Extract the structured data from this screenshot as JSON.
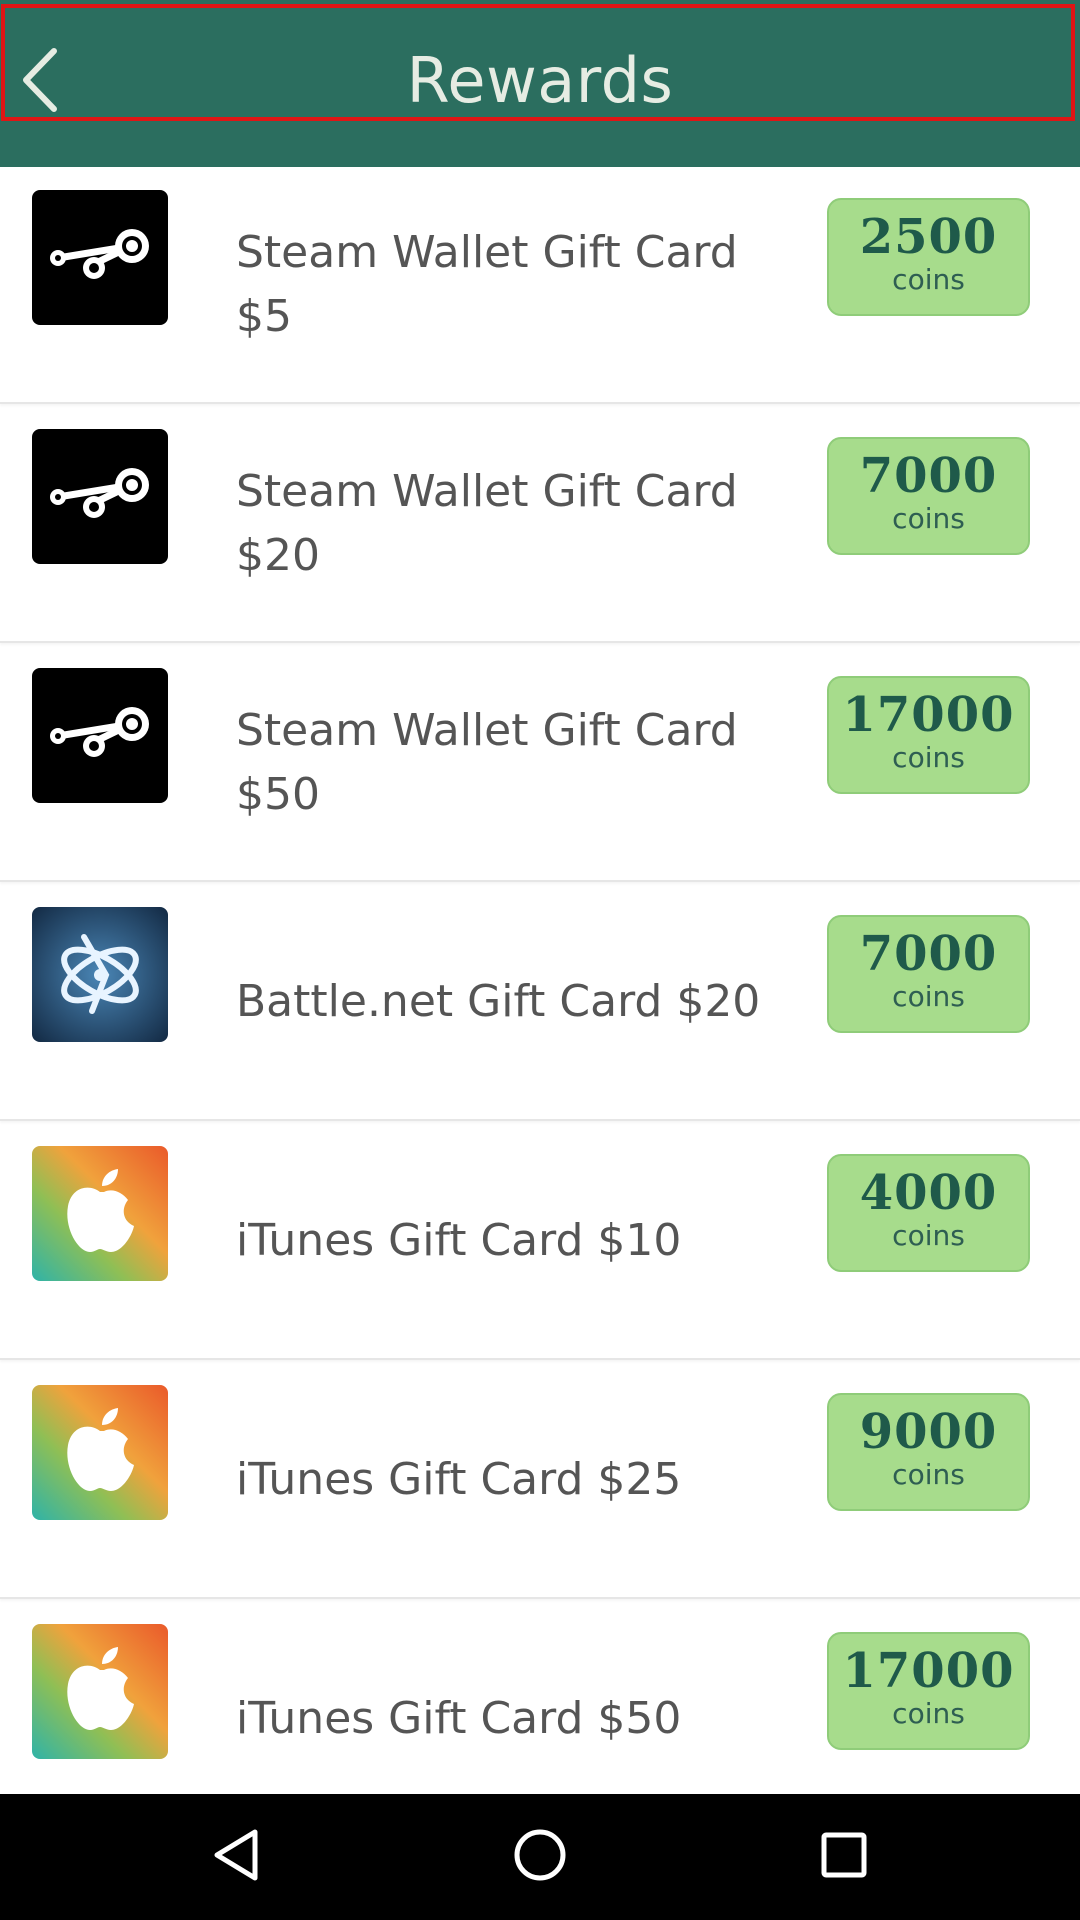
{
  "header": {
    "title": "Rewards",
    "back_icon": "chevron-left-icon",
    "background": "#2b6e5f"
  },
  "rewards": [
    {
      "title_line1": "Steam Wallet Gift Card $5",
      "title_line2": "",
      "icon": "steam-icon",
      "price": "2500",
      "unit": "coins"
    },
    {
      "title_line1": "Steam Wallet Gift Card",
      "title_line2": "$20",
      "icon": "steam-icon",
      "price": "7000",
      "unit": "coins"
    },
    {
      "title_line1": "Steam Wallet Gift Card",
      "title_line2": "$50",
      "icon": "steam-icon",
      "price": "17000",
      "unit": "coins"
    },
    {
      "title_line1": "Battle.net Gift Card $20",
      "title_line2": "",
      "icon": "battlenet-icon",
      "price": "7000",
      "unit": "coins"
    },
    {
      "title_line1": "iTunes Gift Card $10",
      "title_line2": "",
      "icon": "apple-icon",
      "price": "4000",
      "unit": "coins"
    },
    {
      "title_line1": "iTunes Gift Card $25",
      "title_line2": "",
      "icon": "apple-icon",
      "price": "9000",
      "unit": "coins"
    },
    {
      "title_line1": "iTunes Gift Card $50",
      "title_line2": "",
      "icon": "apple-icon",
      "price": "17000",
      "unit": "coins"
    }
  ],
  "navbar": {
    "back_icon": "nav-back-icon",
    "home_icon": "nav-home-icon",
    "recents_icon": "nav-recents-icon"
  },
  "colors": {
    "price_bg": "#a7dc8c",
    "price_text": "#1f5a4a",
    "highlight": "#e01515"
  }
}
